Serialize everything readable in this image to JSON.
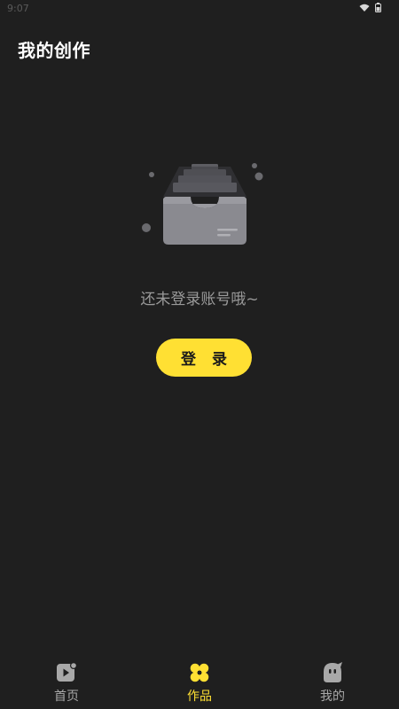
{
  "status_bar": {
    "time": "9:07"
  },
  "header": {
    "title": "我的创作"
  },
  "empty_state": {
    "message": "还未登录账号哦~",
    "login_button_label": "登 录"
  },
  "bottom_nav": {
    "items": [
      {
        "label": "首页",
        "icon": "play-card-icon",
        "active": false
      },
      {
        "label": "作品",
        "icon": "four-petal-icon",
        "active": true
      },
      {
        "label": "我的",
        "icon": "face-icon",
        "active": false
      }
    ]
  },
  "colors": {
    "background": "#1f1f1f",
    "accent": "#ffe033",
    "muted_text": "#9a9a9a",
    "nav_inactive": "#a8a8a8"
  }
}
